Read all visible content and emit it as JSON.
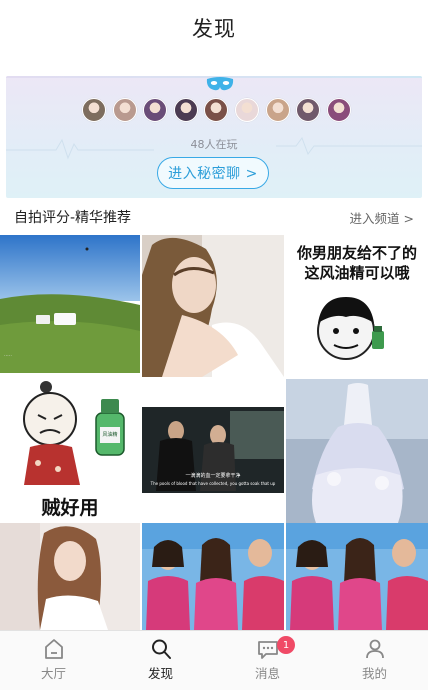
{
  "header": {
    "title": "发现"
  },
  "secret_chat": {
    "playing_count": "48人在玩",
    "enter_label": "进入秘密聊 >",
    "avatar_colors": [
      "#7d6d5e",
      "#b99a8f",
      "#6a4d78",
      "#4b3b52",
      "#7a5048",
      "#e9d8d9",
      "#c9a48a",
      "#70596b",
      "#8a4c7a"
    ],
    "mask_color": "#3fb2e8"
  },
  "section": {
    "title": "自拍评分-精华推荐",
    "link_label": "进入频道 >"
  },
  "grid": {
    "meme1_text": "你男朋友给不了的这风油精可以哦",
    "meme2_text": "贼好用",
    "bottle_label": "风油精",
    "movie_caption_cn": "一滴滴的血一定要拿干净",
    "movie_caption_en": "The pools of blood that have collected, you gotta soak that up"
  },
  "tabbar": {
    "tabs": [
      {
        "label": "大厅",
        "icon": "home-icon"
      },
      {
        "label": "发现",
        "icon": "search-icon"
      },
      {
        "label": "消息",
        "icon": "chat-icon"
      },
      {
        "label": "我的",
        "icon": "person-icon"
      }
    ],
    "message_badge": "1"
  }
}
